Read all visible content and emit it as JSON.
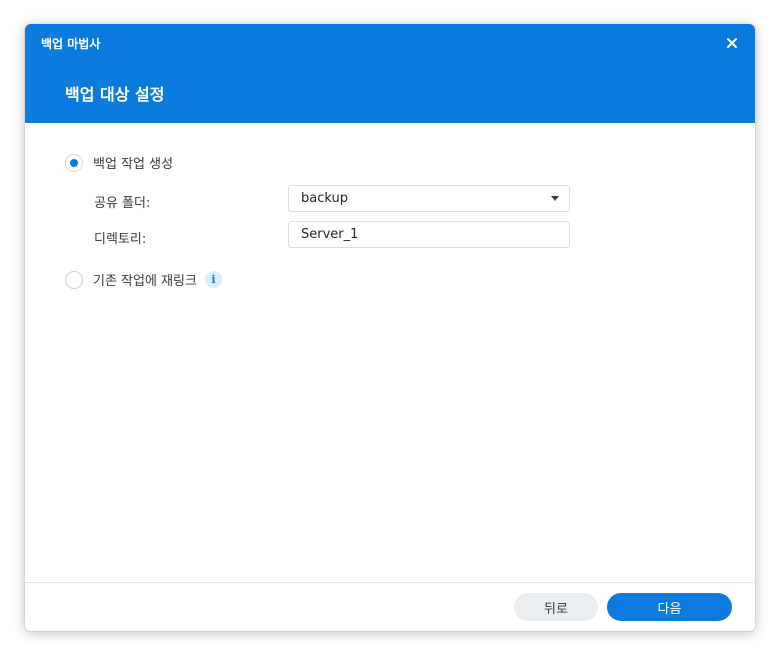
{
  "window": {
    "title": "백업 마법사",
    "close_icon": "close-icon"
  },
  "header": {
    "step_title": "백업 대상 설정"
  },
  "options": {
    "create_task": {
      "label": "백업 작업 생성",
      "checked": true
    },
    "relink_task": {
      "label": "기존 작업에 재링크",
      "checked": false,
      "info_icon": "info-icon",
      "info_glyph": "i"
    }
  },
  "fields": {
    "shared_folder": {
      "label": "공유 폴더:",
      "value": "backup"
    },
    "directory": {
      "label": "디렉토리:",
      "value": "Server_1"
    }
  },
  "footer": {
    "back_label": "뒤로",
    "next_label": "다음"
  },
  "colors": {
    "accent": "#0b7cde",
    "header_text": "#ffffff",
    "secondary_button": "#e9edf0"
  }
}
